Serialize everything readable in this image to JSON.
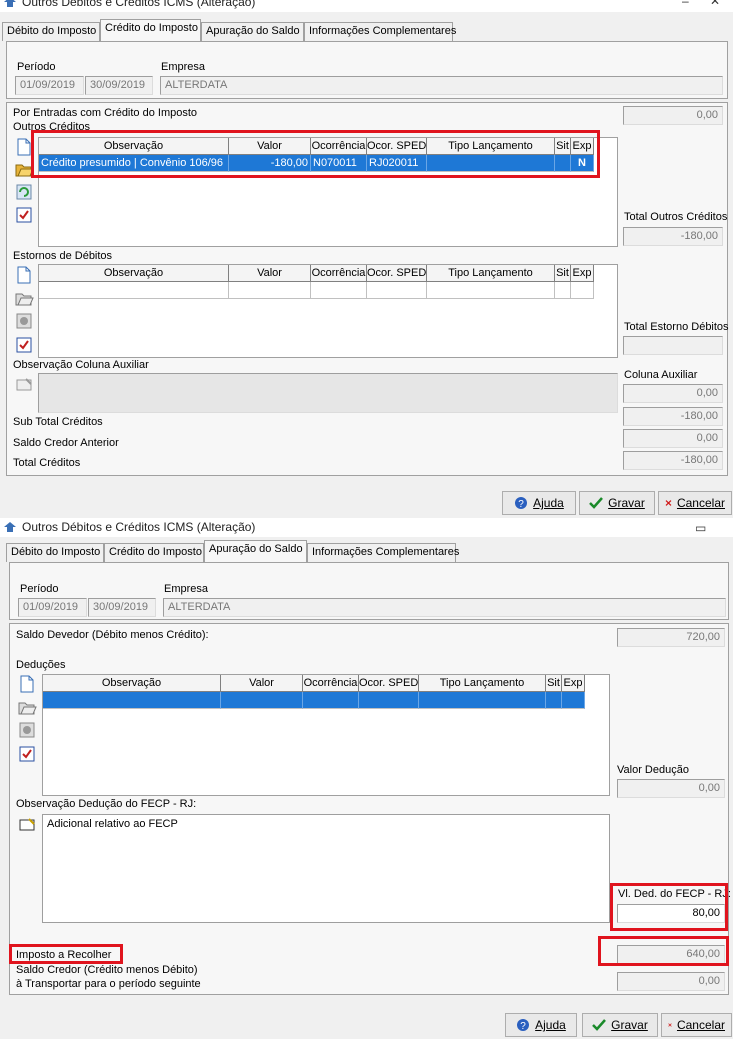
{
  "window1": {
    "title": "Outros Débitos e Créditos ICMS (Alteração)",
    "tabs": [
      "Débito do Imposto",
      "Crédito do Imposto",
      "Apuração do Saldo",
      "Informações Complementares"
    ],
    "periodo_label": "Período",
    "periodo_inicio": "01/09/2019",
    "periodo_fim": "30/09/2019",
    "empresa_label": "Empresa",
    "empresa": "ALTERDATA",
    "entradas_label": "Por Entradas com Crédito do Imposto",
    "entradas_valor": "0,00",
    "outros_creditos_label": "Outros Créditos",
    "grid_headers": [
      "Observação",
      "Valor",
      "Ocorrência",
      "Ocor. SPED",
      "Tipo Lançamento",
      "Sit",
      "Exp"
    ],
    "outros_row": {
      "observacao": "Crédito presumido | Convênio 106/96",
      "valor": "-180,00",
      "ocorrencia": "N070011",
      "ocor_sped": "RJ020011",
      "tipo": "",
      "sit": "",
      "exp": "N"
    },
    "total_outros_label": "Total Outros Créditos",
    "total_outros_valor": "-180,00",
    "estornos_label": "Estornos de Débitos",
    "total_estorno_label": "Total Estorno Débitos",
    "total_estorno_valor": "",
    "obs_aux_label": "Observação Coluna Auxiliar",
    "coluna_aux_label": "Coluna Auxiliar",
    "coluna_aux_valor": "0,00",
    "subtotal_label": "Sub Total Créditos",
    "subtotal_valor": "-180,00",
    "saldo_credor_ant_label": "Saldo Credor Anterior",
    "saldo_credor_ant_valor": "0,00",
    "total_creditos_label": "Total Créditos",
    "total_creditos_valor": "-180,00"
  },
  "buttons": {
    "ajuda": "Ajuda",
    "gravar": "Gravar",
    "cancelar": "Cancelar"
  },
  "window2": {
    "title": "Outros Débitos e Créditos ICMS (Alteração)",
    "tabs": [
      "Débito do Imposto",
      "Crédito do Imposto",
      "Apuração do Saldo",
      "Informações Complementares"
    ],
    "periodo_label": "Período",
    "periodo_inicio": "01/09/2019",
    "periodo_fim": "30/09/2019",
    "empresa_label": "Empresa",
    "empresa": "ALTERDATA",
    "saldo_devedor_label": "Saldo Devedor (Débito menos Crédito):",
    "saldo_devedor_valor": "720,00",
    "deducoes_label": "Deduções",
    "grid_headers": [
      "Observação",
      "Valor",
      "Ocorrência",
      "Ocor. SPED",
      "Tipo Lançamento",
      "Sit",
      "Exp"
    ],
    "valor_deducao_label": "Valor Dedução",
    "valor_deducao_valor": "0,00",
    "obs_deducao_label": "Observação Dedução  do FECP - RJ:",
    "obs_deducao_text": "Adicional relativo ao FECP",
    "vl_ded_fecp_label": "Vl. Ded. do FECP - RJ:",
    "vl_ded_fecp_valor": "80,00",
    "imposto_recolher_label": "Imposto a Recolher",
    "imposto_recolher_valor": "640,00",
    "saldo_credor_label1": "Saldo Credor (Crédito menos Débito)",
    "saldo_credor_label2": "à Transportar para o período seguinte",
    "saldo_credor_valor": "0,00"
  },
  "colors": {
    "highlight": "#e0141e",
    "selection": "#1e78d6"
  }
}
